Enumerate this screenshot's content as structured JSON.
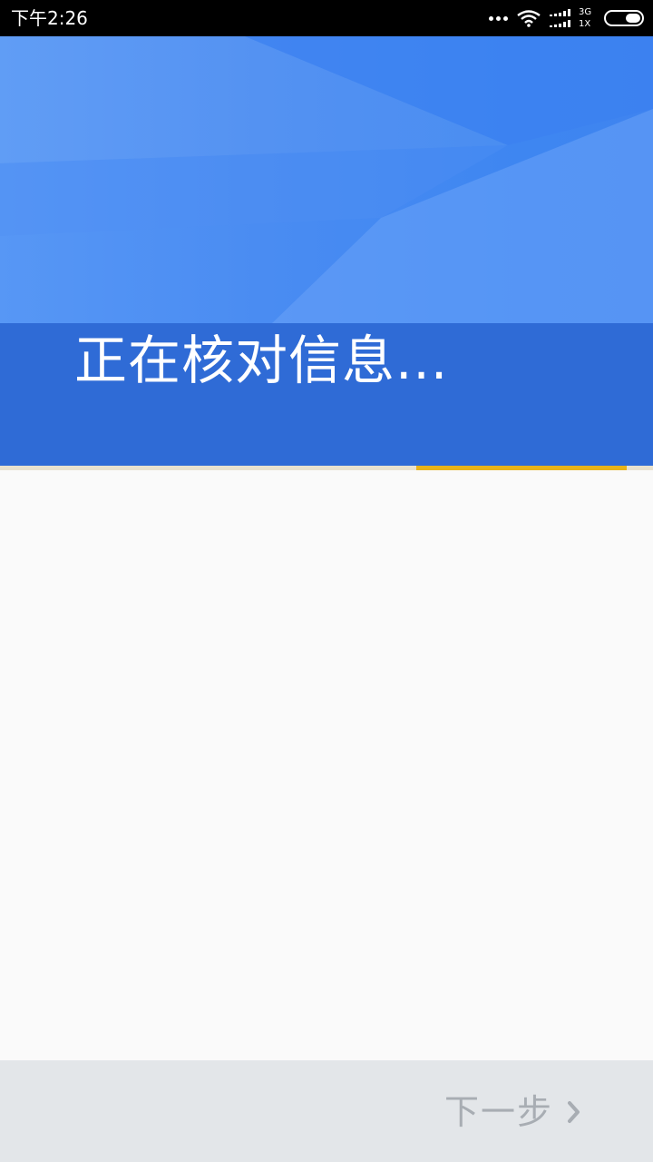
{
  "status_bar": {
    "time": "下午2:26",
    "network_type": "3G",
    "network_type_2": "1X"
  },
  "header": {
    "title": "正在核对信息..."
  },
  "bottom_bar": {
    "next_label": "下一步",
    "next_icon": "chevron-right-icon"
  },
  "colors": {
    "header_blue": "#3f86f2",
    "title_band": "#2f6bd6",
    "progress_accent": "#e8b319",
    "bottom_bar": "#e3e6e9",
    "next_text": "#a8adb3"
  }
}
